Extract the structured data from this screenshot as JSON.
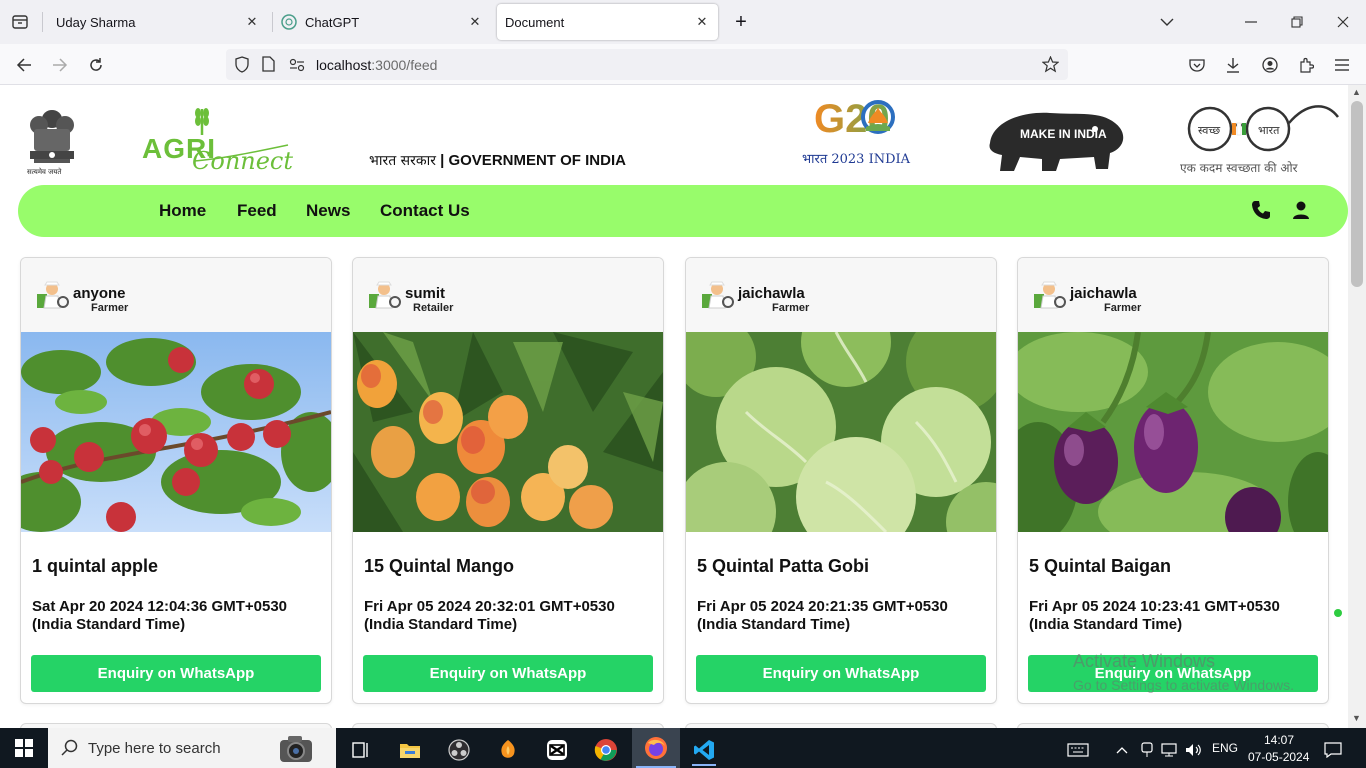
{
  "browser": {
    "tabs": [
      {
        "title": "Uday Sharma",
        "active": false
      },
      {
        "title": "ChatGPT",
        "active": false
      },
      {
        "title": "Document",
        "active": true
      }
    ],
    "url_host": "localhost",
    "url_path": ":3000/feed"
  },
  "header": {
    "emblem_caption": "सत्यमेव जयते",
    "logo_primary": "AGRI",
    "logo_secondary": "Connect",
    "gov_hindi": "भारत सरकार",
    "gov_english": "GOVERNMENT OF INDIA",
    "g20_text": "G20",
    "g20_caption": "भारत 2023 INDIA",
    "make_in_india": "MAKE IN INDIA",
    "swachh_left": "स्वच्छ",
    "swachh_right": "भारत",
    "swachh_tagline": "एक कदम स्वच्छता की ओर"
  },
  "nav": {
    "links": [
      "Home",
      "Feed",
      "News",
      "Contact Us"
    ]
  },
  "posts": [
    {
      "user": "anyone",
      "role": "Farmer",
      "title": "1 quintal apple",
      "date_line1": "Sat Apr 20 2024 12:04:36 GMT+0530",
      "date_line2": "(India Standard Time)",
      "button": "Enquiry on WhatsApp"
    },
    {
      "user": "sumit",
      "role": "Retailer",
      "title": "15 Quintal Mango",
      "date_line1": "Fri Apr 05 2024 20:32:01 GMT+0530",
      "date_line2": "(India Standard Time)",
      "button": "Enquiry on WhatsApp"
    },
    {
      "user": "jaichawla",
      "role": "Farmer",
      "title": "5 Quintal Patta Gobi",
      "date_line1": "Fri Apr 05 2024 20:21:35 GMT+0530",
      "date_line2": "(India Standard Time)",
      "button": "Enquiry on WhatsApp"
    },
    {
      "user": "jaichawla",
      "role": "Farmer",
      "title": "5 Quintal Baigan",
      "date_line1": "Fri Apr 05 2024 10:23:41 GMT+0530",
      "date_line2": "(India Standard Time)",
      "button": "Enquiry on WhatsApp"
    }
  ],
  "watermark": {
    "line1": "Activate Windows",
    "line2": "Go to Settings to activate Windows."
  },
  "taskbar": {
    "search_placeholder": "Type here to search",
    "lang": "ENG",
    "time": "14:07",
    "date": "07-05-2024"
  },
  "colors": {
    "nav_bg": "#98fc6b",
    "whatsapp": "#25d366",
    "taskbar": "#101820"
  }
}
